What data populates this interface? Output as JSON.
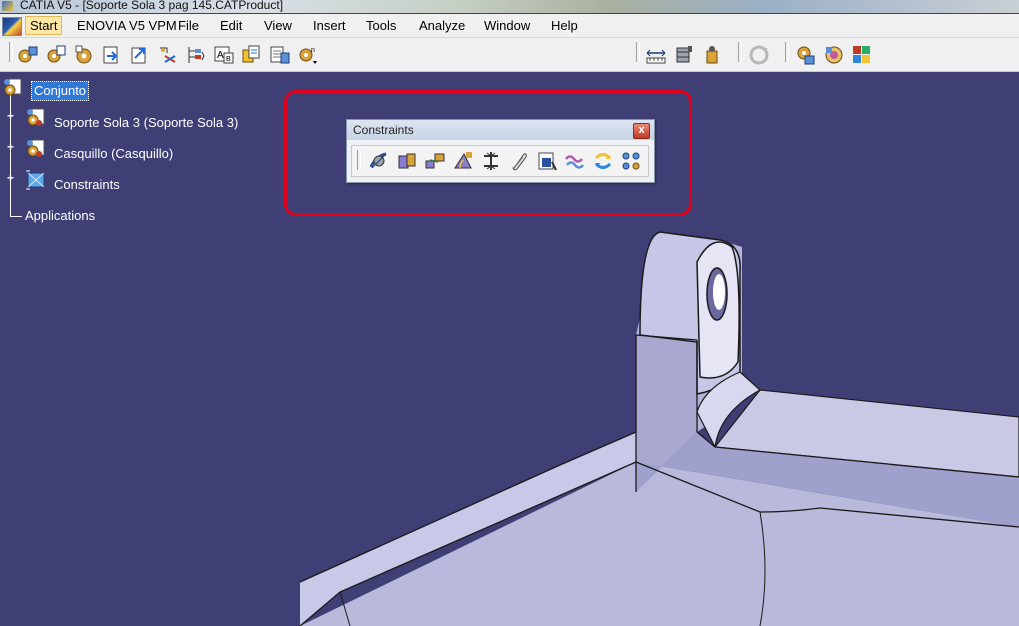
{
  "window": {
    "title": "CATIA V5 - [Soporte Sola 3 pag 145.CATProduct]"
  },
  "menubar": {
    "items": [
      {
        "label": "Start",
        "active": true
      },
      {
        "label": "ENOVIA V5 VPM",
        "active": false
      },
      {
        "label": "File",
        "active": false
      },
      {
        "label": "Edit",
        "active": false
      },
      {
        "label": "View",
        "active": false
      },
      {
        "label": "Insert",
        "active": false
      },
      {
        "label": "Tools",
        "active": false
      },
      {
        "label": "Analyze",
        "active": false
      },
      {
        "label": "Window",
        "active": false
      },
      {
        "label": "Help",
        "active": false
      }
    ]
  },
  "toolbar": {
    "left_icons": [
      "existing-component-icon",
      "existing-component-positioning-icon",
      "new-component-icon",
      "new-product-icon",
      "new-part-icon",
      "replace-component-icon",
      "graph-tree-reordering-icon",
      "generate-numbering-icon",
      "selective-load-icon",
      "manage-representations-icon",
      "multi-instantiation-icon"
    ],
    "right_icons": [
      "measure-between-icon",
      "measure-item-icon",
      "measure-inertia-icon",
      "update-icon",
      "catalog-browser-icon",
      "clash-analysis-icon",
      "apply-material-icon"
    ]
  },
  "tree": {
    "root": {
      "label": "Conjunto",
      "icon": "product-icon"
    },
    "children": [
      {
        "label": "Soporte Sola 3 (Soporte Sola 3)",
        "icon": "component-icon",
        "expander": "+"
      },
      {
        "label": "Casquillo (Casquillo)",
        "icon": "component-icon",
        "expander": "+"
      },
      {
        "label": "Constraints",
        "icon": "constraints-icon",
        "expander": "+"
      }
    ],
    "applications": {
      "label": "Applications"
    }
  },
  "constraints_toolbar": {
    "title": "Constraints",
    "close_label": "x",
    "icons": [
      "coincidence-constraint-icon",
      "contact-constraint-icon",
      "offset-constraint-icon",
      "angle-constraint-icon",
      "fix-component-icon",
      "fix-together-icon",
      "quick-constraint-icon",
      "flexible-rigid-subassembly-icon",
      "change-constraint-icon",
      "reuse-pattern-icon"
    ]
  },
  "colors": {
    "viewport_background": "#3f3f75",
    "highlight_border": "#e3001b",
    "model_face_light": "#c9c9e6",
    "model_face_mid": "#a8a8cf",
    "model_face_dark": "#7d7db0",
    "selection_blue": "#2f78d6"
  }
}
